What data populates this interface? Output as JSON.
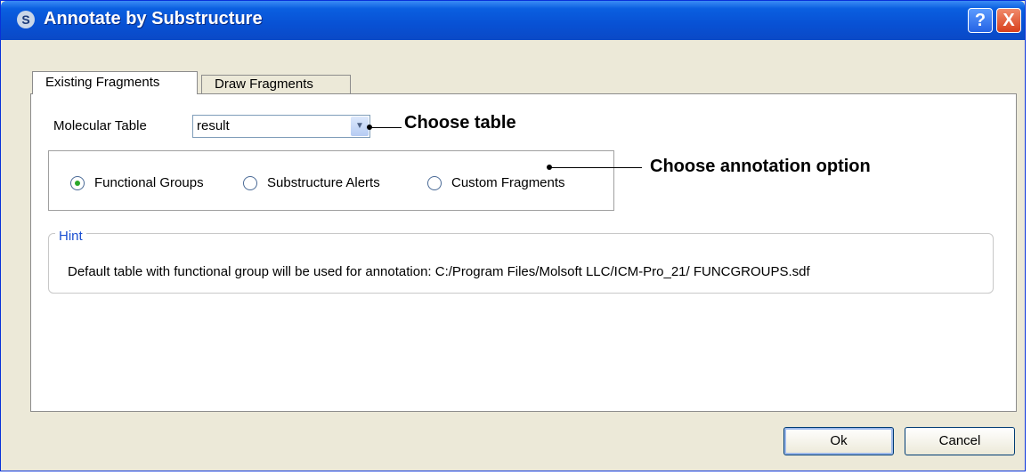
{
  "window": {
    "title": "Annotate by Substructure",
    "help": "?",
    "close": "X"
  },
  "tabs": [
    {
      "label": "Existing Fragments",
      "active": true
    },
    {
      "label": "Draw Fragments",
      "active": false
    }
  ],
  "form": {
    "molecular_table_label": "Molecular Table",
    "molecular_table_value": "result"
  },
  "radio_options": [
    {
      "label": "Functional Groups",
      "selected": true
    },
    {
      "label": "Substructure Alerts",
      "selected": false
    },
    {
      "label": "Custom Fragments",
      "selected": false
    }
  ],
  "annotations": {
    "choose_table": "Choose table",
    "choose_option": "Choose annotation option"
  },
  "hint": {
    "title": "Hint",
    "text": "Default table with functional group will be used for annotation:  C:/Program Files/Molsoft LLC/ICM-Pro_21/ FUNCGROUPS.sdf"
  },
  "buttons": {
    "ok": "Ok",
    "cancel": "Cancel"
  },
  "colors": {
    "title_bar": "#0851d4",
    "hint_title": "#1a4fd1",
    "radio_selected": "#2aa82a"
  }
}
